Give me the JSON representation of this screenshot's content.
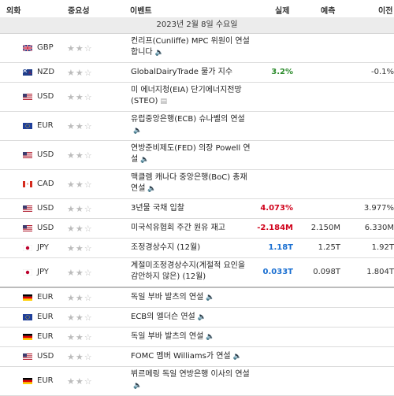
{
  "header": {
    "currency": "외화",
    "importance": "중요성",
    "event": "이벤트",
    "actual": "실제",
    "forecast": "예측",
    "previous": "이전"
  },
  "date_label": "2023년 2월 8일 수요일",
  "rows": [
    {
      "flag": "gb",
      "currency": "GBP",
      "stars": "★★☆",
      "event": "컨리프(Cunliffe) MPC 위원이 연설합니다",
      "icon": "speaker-icon",
      "actual": "",
      "actual_color": "",
      "forecast": "",
      "previous": "",
      "h": 2
    },
    {
      "flag": "nz",
      "currency": "NZD",
      "stars": "★★☆",
      "event": "GlobalDairyTrade 물가 지수",
      "icon": "",
      "actual": "3.2%",
      "actual_color": "#2a8a2a",
      "forecast": "",
      "previous": "-0.1%",
      "h": 1
    },
    {
      "flag": "us",
      "currency": "USD",
      "stars": "★★☆",
      "event": "미 에너지청(EIA) 단기에너지전망(STEO)",
      "icon": "report-icon",
      "actual": "",
      "actual_color": "",
      "forecast": "",
      "previous": "",
      "h": 2
    },
    {
      "flag": "eu",
      "currency": "EUR",
      "stars": "★★☆",
      "event": "유럽중앙은행(ECB) 슈나벨의 연설",
      "icon": "speaker-icon",
      "actual": "",
      "actual_color": "",
      "forecast": "",
      "previous": "",
      "h": 2
    },
    {
      "flag": "us",
      "currency": "USD",
      "stars": "★★☆",
      "event": "연방준비제도(FED) 의장 Powell 연설",
      "icon": "speaker-icon",
      "actual": "",
      "actual_color": "",
      "forecast": "",
      "previous": "",
      "h": 2
    },
    {
      "flag": "ca",
      "currency": "CAD",
      "stars": "★★☆",
      "event": "맥클렘 캐나다 중앙은행(BoC) 총재 연설",
      "icon": "speaker-icon",
      "actual": "",
      "actual_color": "",
      "forecast": "",
      "previous": "",
      "h": 2
    },
    {
      "flag": "us",
      "currency": "USD",
      "stars": "★★☆",
      "event": "3년물 국채 입찰",
      "icon": "",
      "actual": "4.073%",
      "actual_color": "#d0021b",
      "forecast": "",
      "previous": "3.977%",
      "h": 1
    },
    {
      "flag": "us",
      "currency": "USD",
      "stars": "★★☆",
      "event": "미국석유협회 주간 원유 재고",
      "icon": "",
      "actual": "-2.184M",
      "actual_color": "#d0021b",
      "forecast": "2.150M",
      "previous": "6.330M",
      "h": 1
    },
    {
      "flag": "jp",
      "currency": "JPY",
      "stars": "★★☆",
      "event": "조정경상수지 (12월)",
      "icon": "",
      "actual": "1.18T",
      "actual_color": "#1a6fd1",
      "forecast": "1.25T",
      "previous": "1.92T",
      "h": 1
    },
    {
      "flag": "jp",
      "currency": "JPY",
      "stars": "★★☆",
      "event": "계절미조정경상수지(계절적 요인을 감안하지 않은) (12월)",
      "icon": "",
      "actual": "0.033T",
      "actual_color": "#1a6fd1",
      "forecast": "0.098T",
      "previous": "1.804T",
      "h": 2,
      "sep": true
    },
    {
      "flag": "de",
      "currency": "EUR",
      "stars": "★★☆",
      "event": "독일 부바 발츠의 연설",
      "icon": "speaker-icon",
      "actual": "",
      "actual_color": "",
      "forecast": "",
      "previous": "",
      "h": 1
    },
    {
      "flag": "eu",
      "currency": "EUR",
      "stars": "★★☆",
      "event": "ECB의 엘더슨 연설",
      "icon": "speaker-icon",
      "actual": "",
      "actual_color": "",
      "forecast": "",
      "previous": "",
      "h": 1
    },
    {
      "flag": "de",
      "currency": "EUR",
      "stars": "★★☆",
      "event": "독일 부바 발츠의 연설",
      "icon": "speaker-icon",
      "actual": "",
      "actual_color": "",
      "forecast": "",
      "previous": "",
      "h": 1
    },
    {
      "flag": "us",
      "currency": "USD",
      "stars": "★★☆",
      "event": "FOMC 멤버 Williams가 연설",
      "icon": "speaker-icon",
      "actual": "",
      "actual_color": "",
      "forecast": "",
      "previous": "",
      "h": 1
    },
    {
      "flag": "de",
      "currency": "EUR",
      "stars": "★★☆",
      "event": "뷔르메링 독일 연방은행 이사의 연설",
      "icon": "speaker-icon",
      "actual": "",
      "actual_color": "",
      "forecast": "",
      "previous": "",
      "h": 2
    }
  ]
}
